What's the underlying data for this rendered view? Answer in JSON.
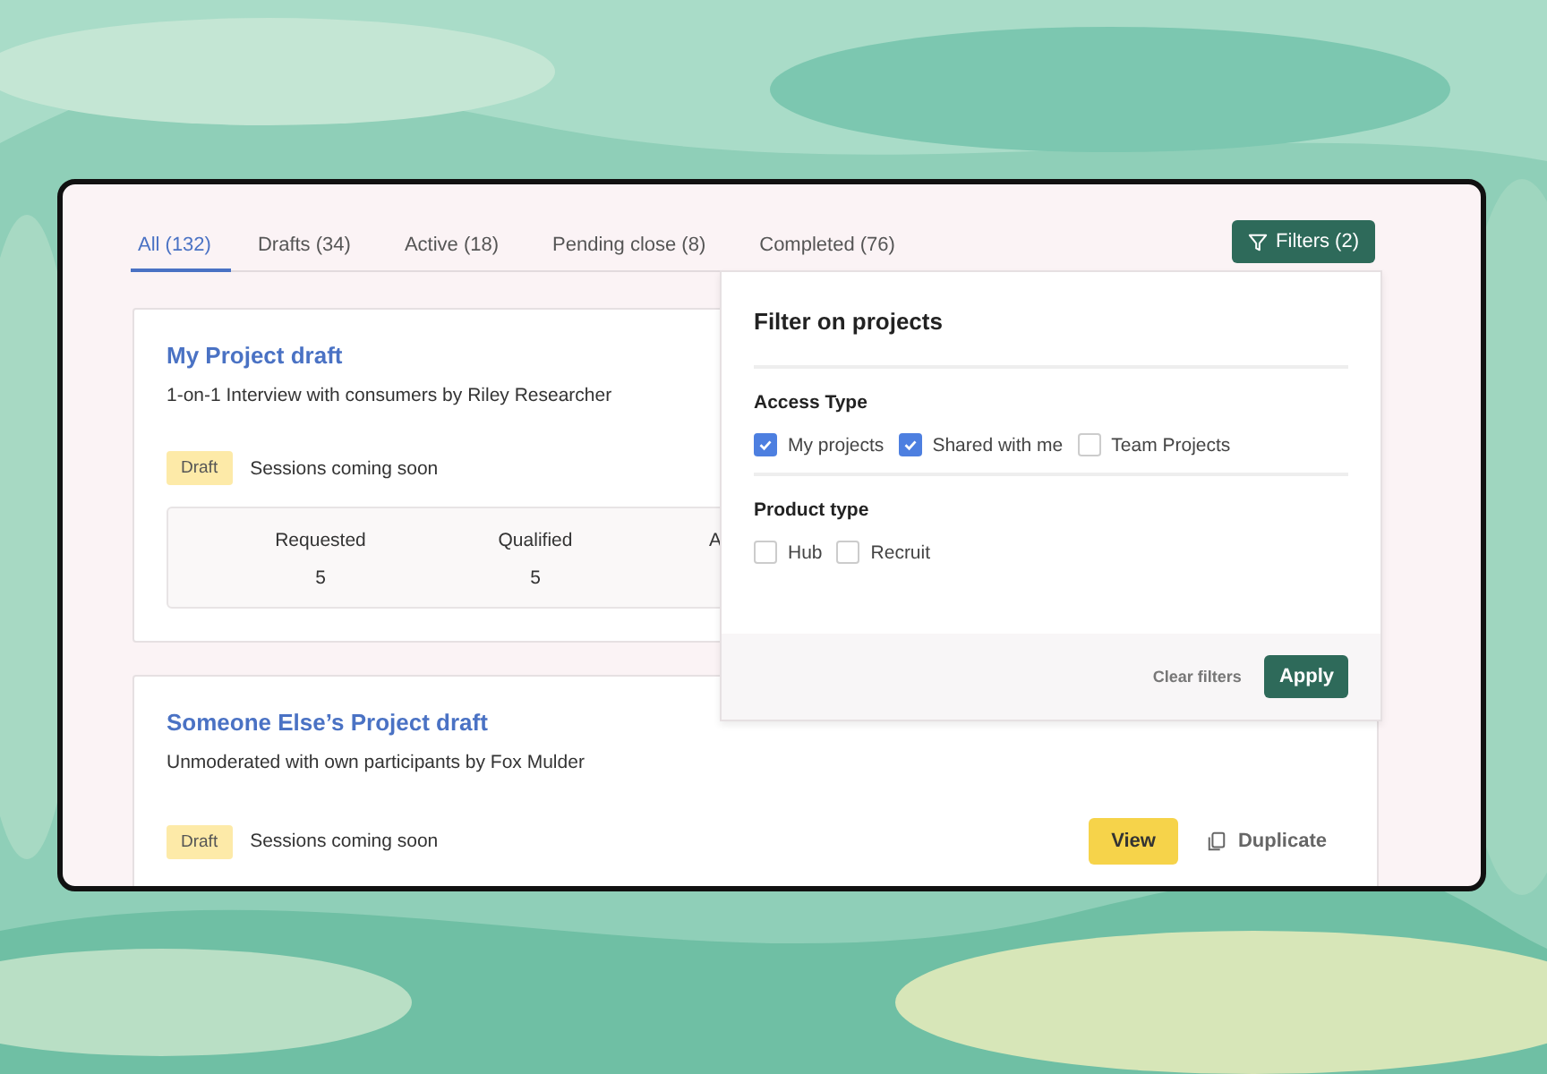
{
  "tabs": [
    {
      "label": "All (132)",
      "selected": true
    },
    {
      "label": "Drafts (34)",
      "selected": false
    },
    {
      "label": "Active (18)",
      "selected": false
    },
    {
      "label": "Pending close (8)",
      "selected": false
    },
    {
      "label": "Completed (76)",
      "selected": false
    }
  ],
  "filters_button": {
    "label": "Filters (2)"
  },
  "projects": [
    {
      "title": "My Project draft",
      "subtitle": "1-on-1 Interview with consumers by Riley Researcher",
      "badge": "Draft",
      "status": "Sessions coming soon",
      "stats": [
        {
          "label": "Requested",
          "value": "5"
        },
        {
          "label": "Qualified",
          "value": "5"
        },
        {
          "label": "A"
        }
      ]
    },
    {
      "title": "Someone Else’s Project draft",
      "subtitle": "Unmoderated with own participants by Fox Mulder",
      "badge": "Draft",
      "status": "Sessions coming soon",
      "actions": {
        "view": "View",
        "duplicate": "Duplicate"
      }
    }
  ],
  "filter_panel": {
    "title": "Filter on projects",
    "groups": [
      {
        "heading": "Access Type",
        "options": [
          {
            "label": "My projects",
            "checked": true
          },
          {
            "label": "Shared with me",
            "checked": true
          },
          {
            "label": "Team Projects",
            "checked": false
          }
        ]
      },
      {
        "heading": "Product type",
        "options": [
          {
            "label": "Hub",
            "checked": false
          },
          {
            "label": "Recruit",
            "checked": false
          }
        ]
      }
    ],
    "clear": "Clear filters",
    "apply": "Apply"
  }
}
